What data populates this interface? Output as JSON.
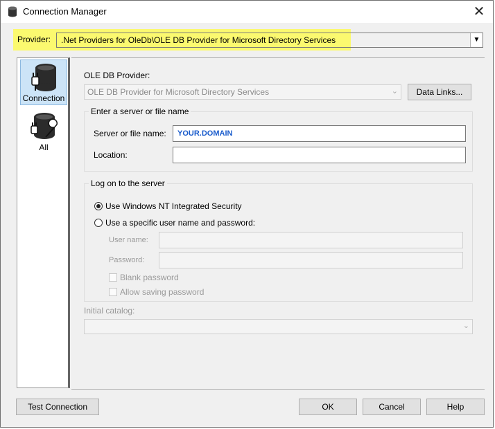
{
  "window": {
    "title": "Connection Manager",
    "close_glyph": "✕"
  },
  "provider": {
    "label": "Provider:",
    "value": ".Net Providers for OleDb\\OLE DB Provider for Microsoft Directory Services"
  },
  "nav": [
    {
      "label": "Connection",
      "icon": "database-plug-icon",
      "selected": true
    },
    {
      "label": "All",
      "icon": "database-wrench-icon",
      "selected": false
    }
  ],
  "oledb": {
    "label": "OLE DB Provider:",
    "value": "OLE DB Provider for Microsoft Directory Services",
    "data_links_label": "Data Links..."
  },
  "server_group": {
    "title": "Enter a server or file name",
    "server_label": "Server or file name:",
    "server_value": "YOUR.DOMAIN",
    "location_label": "Location:",
    "location_value": ""
  },
  "logon_group": {
    "title": "Log on to the server",
    "option_nt": "Use Windows NT Integrated Security",
    "option_specific": "Use a specific user name and password:",
    "username_label": "User name:",
    "password_label": "Password:",
    "blank_password": "Blank password",
    "allow_saving": "Allow saving password"
  },
  "catalog": {
    "label": "Initial catalog:"
  },
  "buttons": {
    "test": "Test Connection",
    "ok": "OK",
    "cancel": "Cancel",
    "help": "Help"
  },
  "colors": {
    "highlight": "#fbf96f",
    "selection": "#cce4f7",
    "server_text": "#1a5ccc"
  }
}
